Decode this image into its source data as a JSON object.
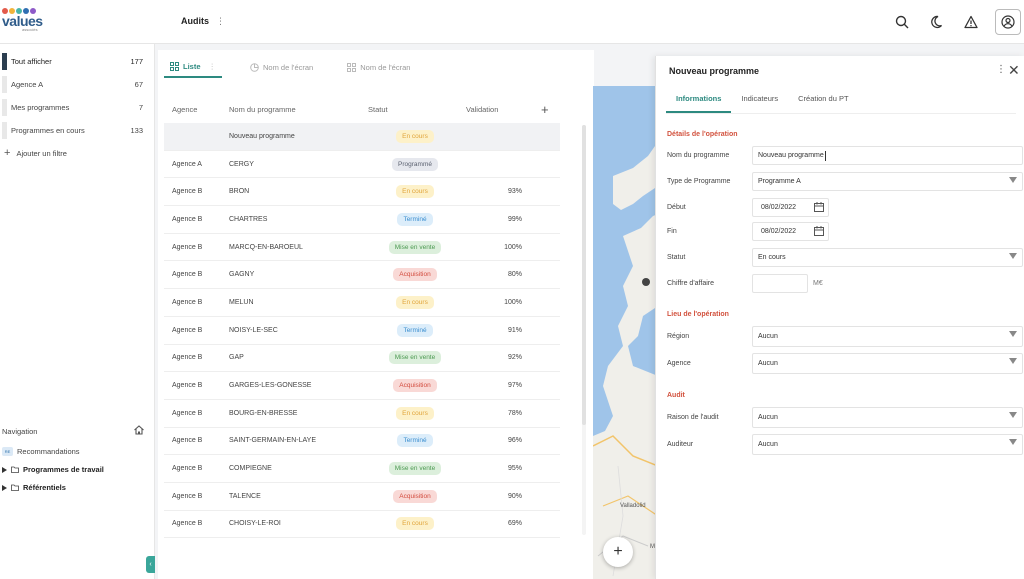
{
  "logo": {
    "text": "values",
    "subtitle": "associés",
    "dot_colors": [
      "#e35a4a",
      "#f2b43a",
      "#4ab6a8",
      "#2f6fb2",
      "#8e5ac8"
    ]
  },
  "header": {
    "title": "Audits",
    "kebab": "⋮"
  },
  "sidebar": {
    "filters": [
      {
        "label": "Tout afficher",
        "count": "177"
      },
      {
        "label": "Agence A",
        "count": "67"
      },
      {
        "label": "Mes programmes",
        "count": "7"
      },
      {
        "label": "Programmes en cours",
        "count": "133"
      }
    ],
    "add_filter": "Ajouter un filtre",
    "navigation_title": "Navigation",
    "nav_items": [
      {
        "label": "Recommandations",
        "badge": "RE"
      },
      {
        "label": "Programmes de travail"
      },
      {
        "label": "Référentiels"
      }
    ]
  },
  "view_tabs": [
    {
      "label": "Liste",
      "extra": "⋮"
    },
    {
      "label": "Nom de l'écran"
    },
    {
      "label": "Nom de l'écran"
    }
  ],
  "table": {
    "columns": [
      "Agence",
      "Nom du programme",
      "Statut",
      "Validation"
    ],
    "rows": [
      {
        "agence": "",
        "programme": "Nouveau programme",
        "statut": "En cours",
        "validation": ""
      },
      {
        "agence": "Agence A",
        "programme": "CERGY",
        "statut": "Programmé",
        "validation": ""
      },
      {
        "agence": "Agence B",
        "programme": "BRON",
        "statut": "En cours",
        "validation": "93%"
      },
      {
        "agence": "Agence B",
        "programme": "CHARTRES",
        "statut": "Terminé",
        "validation": "99%"
      },
      {
        "agence": "Agence B",
        "programme": "MARCQ-EN-BAROEUL",
        "statut": "Mise en vente",
        "validation": "100%"
      },
      {
        "agence": "Agence B",
        "programme": "GAGNY",
        "statut": "Acquisition",
        "validation": "80%"
      },
      {
        "agence": "Agence B",
        "programme": "MELUN",
        "statut": "En cours",
        "validation": "100%"
      },
      {
        "agence": "Agence B",
        "programme": "NOISY-LE-SEC",
        "statut": "Terminé",
        "validation": "91%"
      },
      {
        "agence": "Agence B",
        "programme": "GAP",
        "statut": "Mise en vente",
        "validation": "92%"
      },
      {
        "agence": "Agence B",
        "programme": "GARGES-LES-GONESSE",
        "statut": "Acquisition",
        "validation": "97%"
      },
      {
        "agence": "Agence B",
        "programme": "BOURG-EN-BRESSE",
        "statut": "En cours",
        "validation": "78%"
      },
      {
        "agence": "Agence B",
        "programme": "SAINT-GERMAIN-EN-LAYE",
        "statut": "Terminé",
        "validation": "96%"
      },
      {
        "agence": "Agence B",
        "programme": "COMPIEGNE",
        "statut": "Mise en vente",
        "validation": "95%"
      },
      {
        "agence": "Agence B",
        "programme": "TALENCE",
        "statut": "Acquisition",
        "validation": "90%"
      },
      {
        "agence": "Agence B",
        "programme": "CHOISY-LE-ROI",
        "statut": "En cours",
        "validation": "69%"
      }
    ]
  },
  "status_colors": {
    "En cours": {
      "bg": "#fdf1c9",
      "fg": "#e0a43a"
    },
    "Programmé": {
      "bg": "#e6e8ee",
      "fg": "#5b6170"
    },
    "Terminé": {
      "bg": "#dcedfa",
      "fg": "#3a8ed0"
    },
    "Mise en vente": {
      "bg": "#dcefdc",
      "fg": "#4d9a52"
    },
    "Acquisition": {
      "bg": "#f9d9d6",
      "fg": "#d24a3d"
    }
  },
  "map": {
    "label_valladolid": "Valladolid",
    "label_m": "M",
    "add": "+"
  },
  "panel": {
    "title": "Nouveau programme",
    "tabs": [
      "Informations",
      "Indicateurs",
      "Création du PT"
    ],
    "sections": {
      "details": "Détails de l'opération",
      "lieu": "Lieu de l'opération",
      "audit": "Audit"
    },
    "fields": {
      "nom_label": "Nom du programme",
      "nom_value": "Nouveau programme",
      "type_label": "Type de Programme",
      "type_value": "Programme A",
      "debut_label": "Début",
      "debut_value": "08/02/2022",
      "fin_label": "Fin",
      "fin_value": "08/02/2022",
      "statut_label": "Statut",
      "statut_value": "En cours",
      "ca_label": "Chiffre d'affaire",
      "ca_value": "",
      "ca_unit": "M€",
      "region_label": "Région",
      "region_value": "Aucun",
      "agence_label": "Agence",
      "agence_value": "Aucun",
      "raison_label": "Raison de l'audit",
      "raison_value": "Aucun",
      "auditeur_label": "Auditeur",
      "auditeur_value": "Aucun"
    }
  },
  "accent": "#2d8a80"
}
